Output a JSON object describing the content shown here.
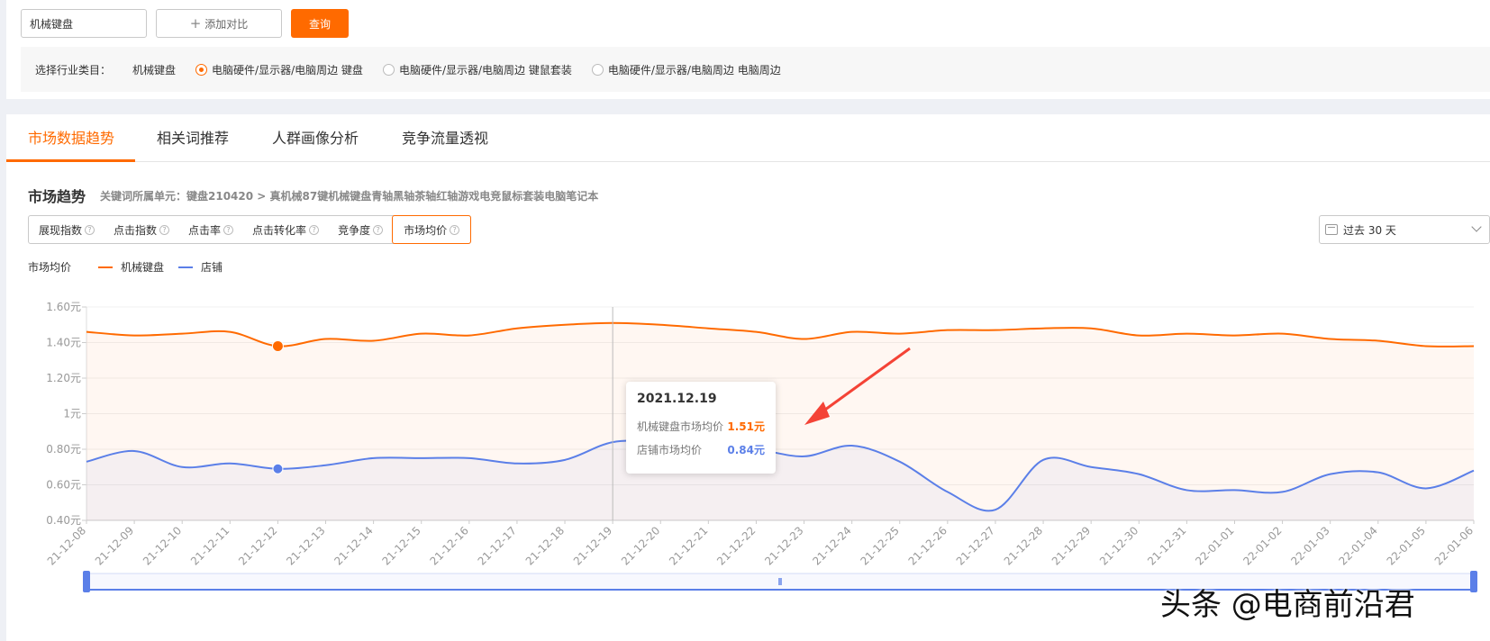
{
  "search": {
    "keyword": "机械键盘",
    "add_compare_label": "添加对比",
    "query_label": "查询"
  },
  "industry": {
    "label": "选择行业类目：",
    "keyword": "机械键盘",
    "options": [
      {
        "label": "电脑硬件/显示器/电脑周边 键盘",
        "checked": true
      },
      {
        "label": "电脑硬件/显示器/电脑周边 键鼠套装",
        "checked": false
      },
      {
        "label": "电脑硬件/显示器/电脑周边 电脑周边",
        "checked": false
      }
    ]
  },
  "tabs": [
    {
      "label": "市场数据趋势",
      "active": true
    },
    {
      "label": "相关词推荐",
      "active": false
    },
    {
      "label": "人群画像分析",
      "active": false
    },
    {
      "label": "竞争流量透视",
      "active": false
    }
  ],
  "section": {
    "title": "市场趋势",
    "path": "关键词所属单元：键盘210420 > 真机械87键机械键盘青轴黑轴茶轴红轴游戏电竞鼠标套装电脑笔记本"
  },
  "metrics": [
    {
      "label": "展现指数",
      "help": true,
      "active": false
    },
    {
      "label": "点击指数",
      "help": true,
      "active": false
    },
    {
      "label": "点击率",
      "help": true,
      "active": false
    },
    {
      "label": "点击转化率",
      "help": true,
      "active": false
    },
    {
      "label": "竞争度",
      "help": true,
      "active": false
    },
    {
      "label": "市场均价",
      "help": true,
      "active": true
    }
  ],
  "date_range": {
    "label": "过去 30 天"
  },
  "tooltip": {
    "date": "2021.12.19",
    "rows": [
      {
        "label": "机械键盘市场均价",
        "value": "1.51元",
        "color": "#ff6a00"
      },
      {
        "label": "店铺市场均价",
        "value": "0.84元",
        "color": "#5b7fe8"
      }
    ]
  },
  "watermark": "头条 @电商前沿君",
  "chart_data": {
    "type": "line",
    "legend_title": "市场均价",
    "x": [
      "21-12-08",
      "21-12-09",
      "21-12-10",
      "21-12-11",
      "21-12-12",
      "21-12-13",
      "21-12-14",
      "21-12-15",
      "21-12-16",
      "21-12-17",
      "21-12-18",
      "21-12-19",
      "21-12-20",
      "21-12-21",
      "21-12-22",
      "21-12-23",
      "21-12-24",
      "21-12-25",
      "21-12-26",
      "21-12-27",
      "21-12-28",
      "21-12-29",
      "21-12-30",
      "21-12-31",
      "22-01-01",
      "22-01-02",
      "22-01-03",
      "22-01-04",
      "22-01-05",
      "22-01-06"
    ],
    "yticks": [
      "0.40元",
      "0.60元",
      "0.80元",
      "1元",
      "1.20元",
      "1.40元",
      "1.60元"
    ],
    "ylim": [
      0.4,
      1.6
    ],
    "series": [
      {
        "name": "机械键盘",
        "color": "#ff6a00",
        "values": [
          1.46,
          1.44,
          1.45,
          1.46,
          1.38,
          1.42,
          1.41,
          1.45,
          1.44,
          1.48,
          1.5,
          1.51,
          1.5,
          1.48,
          1.46,
          1.42,
          1.46,
          1.45,
          1.47,
          1.47,
          1.48,
          1.48,
          1.44,
          1.45,
          1.44,
          1.45,
          1.42,
          1.41,
          1.38,
          1.38
        ]
      },
      {
        "name": "店铺",
        "color": "#5b7fe8",
        "values": [
          0.73,
          0.79,
          0.7,
          0.72,
          0.69,
          0.71,
          0.75,
          0.75,
          0.75,
          0.72,
          0.74,
          0.84,
          0.84,
          0.82,
          0.8,
          0.76,
          0.82,
          0.73,
          0.56,
          0.46,
          0.74,
          0.7,
          0.66,
          0.57,
          0.57,
          0.56,
          0.66,
          0.67,
          0.58,
          0.68
        ]
      }
    ],
    "highlight_index": 11,
    "grid": true,
    "legend_position": "top-left"
  }
}
